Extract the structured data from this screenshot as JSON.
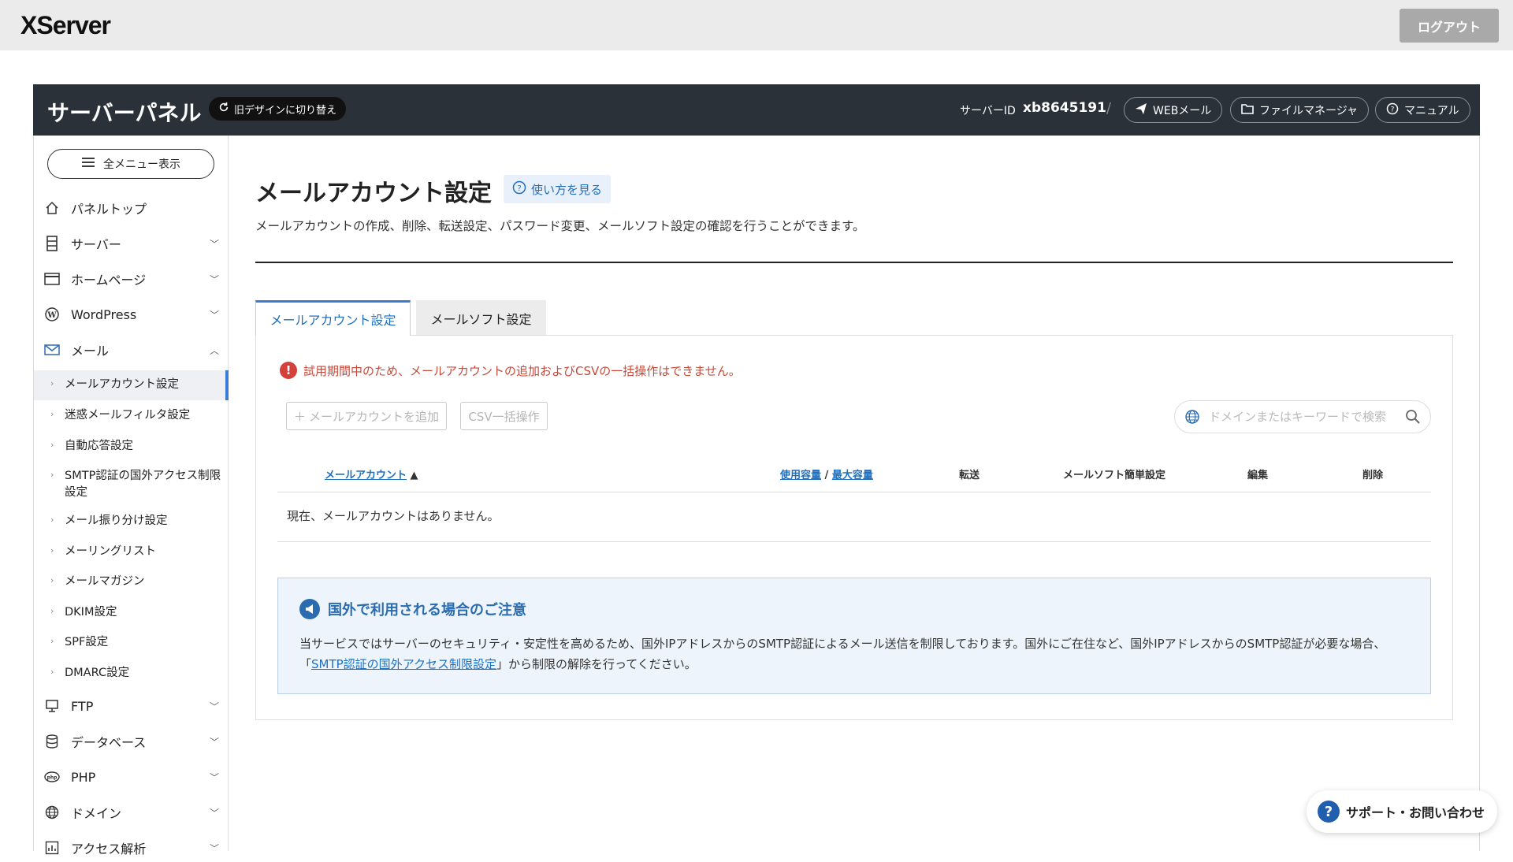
{
  "topbar": {
    "logo": "XServer",
    "logout_label": "ログアウト"
  },
  "panel": {
    "title": "サーバーパネル",
    "old_design_label": "旧デザインに切り替え",
    "server_id_label": "サーバーID",
    "server_id_value": "xb8645191",
    "separator": "/",
    "links": {
      "webmail": "WEBメール",
      "filemanager": "ファイルマネージャ",
      "manual": "マニュアル"
    }
  },
  "sidebar": {
    "all_menu_label": "全メニュー表示",
    "items": {
      "top": "パネルトップ",
      "server": "サーバー",
      "homepage": "ホームページ",
      "wordpress": "WordPress",
      "mail": "メール",
      "ftp": "FTP",
      "database": "データベース",
      "php": "PHP",
      "domain": "ドメイン",
      "access": "アクセス解析"
    },
    "mail_sub": [
      "メールアカウント設定",
      "迷惑メールフィルタ設定",
      "自動応答設定",
      "SMTP認証の国外アクセス制限設定",
      "メール振り分け設定",
      "メーリングリスト",
      "メールマガジン",
      "DKIM設定",
      "SPF設定",
      "DMARC設定"
    ]
  },
  "main": {
    "title": "メールアカウント設定",
    "howto_label": "使い方を見る",
    "description": "メールアカウントの作成、削除、転送設定、パスワード変更、メールソフト設定の確認を行うことができます。",
    "tabs": {
      "account": "メールアカウント設定",
      "software": "メールソフト設定"
    },
    "warning": "試用期間中のため、メールアカウントの追加およびCSVの一括操作はできません。",
    "add_button": "メールアカウントを追加",
    "csv_button": "CSV一括操作",
    "search_placeholder": "ドメインまたはキーワードで検索",
    "table": {
      "col_account": "メールアカウント",
      "sort_arrow": "▲",
      "col_usage": "使用容量",
      "col_sep": " / ",
      "col_max": "最大容量",
      "col_forward": "転送",
      "col_mailsoft": "メールソフト簡単設定",
      "col_edit": "編集",
      "col_delete": "削除",
      "empty": "現在、メールアカウントはありません。"
    },
    "notice": {
      "title": "国外で利用される場合のご注意",
      "body_1": "当サービスではサーバーのセキュリティ・安定性を高めるため、国外IPアドレスからのSMTP認証によるメール送信を制限しております。国外にご在住など、国外IPアドレスからのSMTP認証が必要な場合、「",
      "link": "SMTP認証の国外アクセス制限設定",
      "body_2": "」から制限の解除を行ってください。"
    }
  },
  "support_label": "サポート・お問い合わせ"
}
